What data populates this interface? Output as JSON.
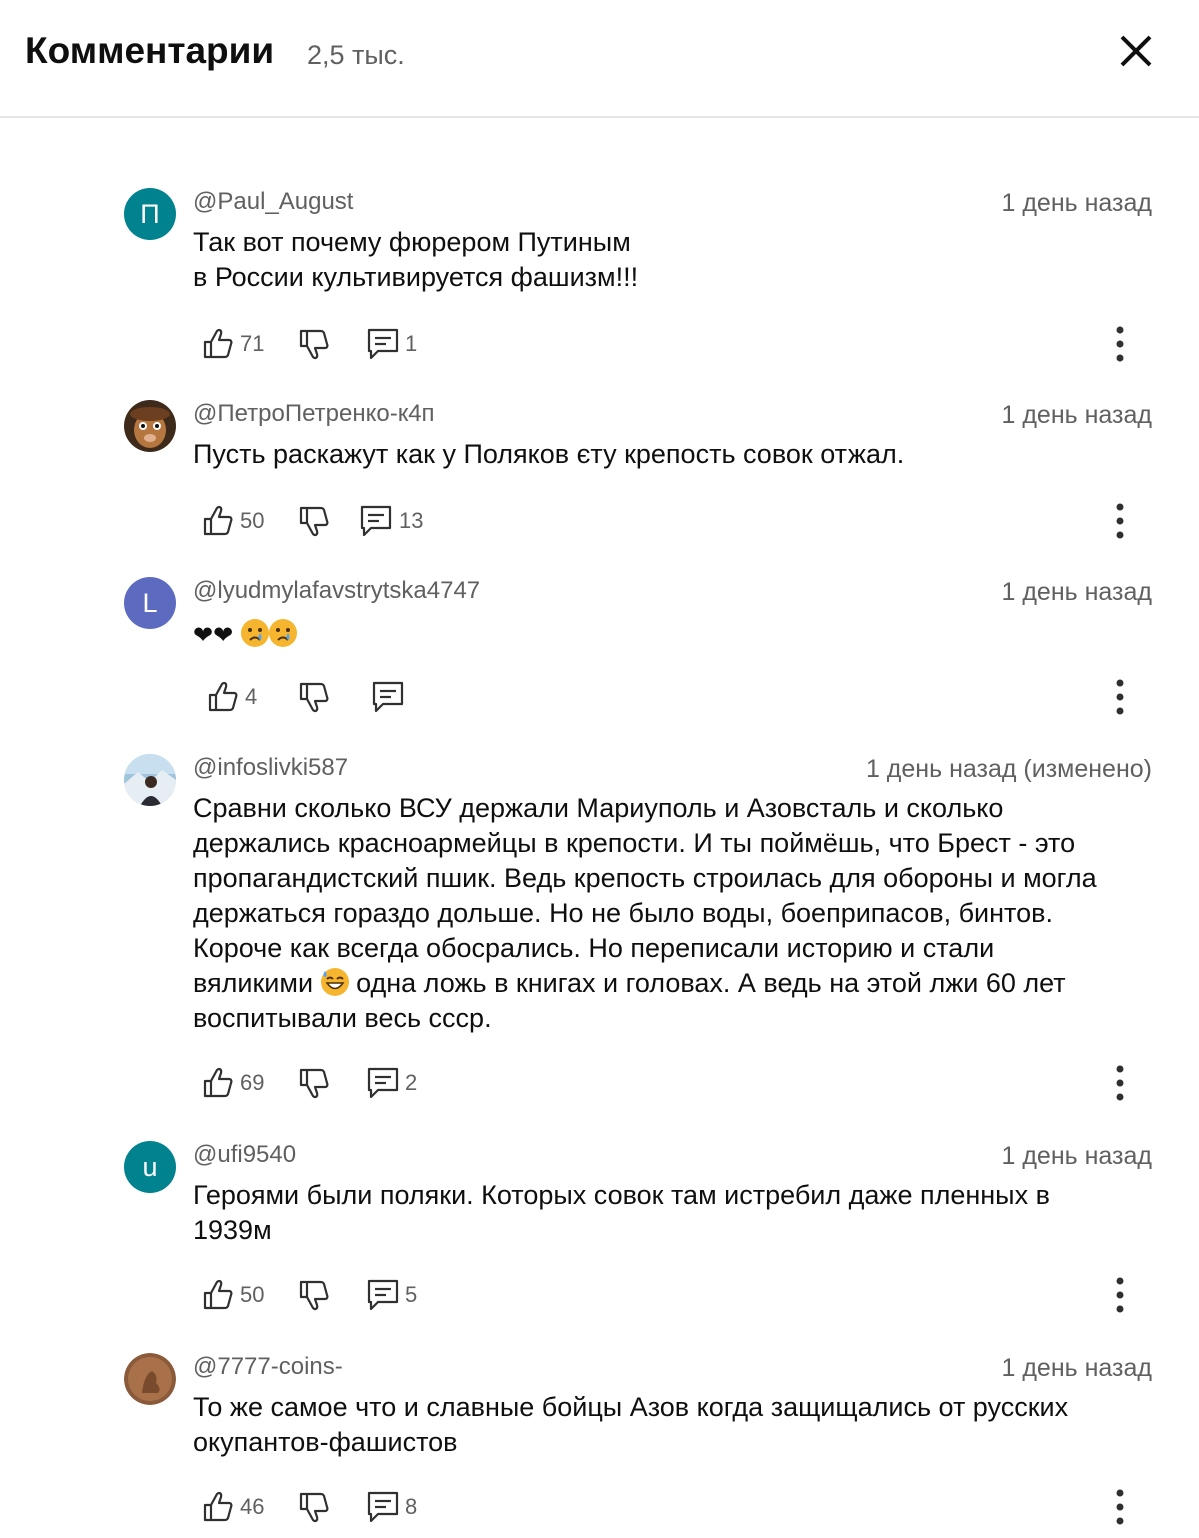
{
  "header": {
    "title": "Комментарии",
    "count": "2,5 тыс."
  },
  "colors": {
    "teal": "#00838f",
    "indigo": "#5c6bc0",
    "secondary": "#606060"
  },
  "comments": [
    {
      "author": "@Paul_August",
      "avatar_letter": "П",
      "time": "1 день назад",
      "lines": [
        "Так вот почему фюрером Путиным",
        "в России культивируется фашизм!!!"
      ],
      "likes": "71",
      "replies": "1"
    },
    {
      "author": "@ПетроПетренко-к4п",
      "avatar_letter": "",
      "time": "1 день назад",
      "lines": [
        "Пусть раскажут как у Поляков єту крепость совок отжал."
      ],
      "likes": "50",
      "replies": "13"
    },
    {
      "author": "@lyudmylafavstrytska4747",
      "avatar_letter": "L",
      "time": "1 день назад",
      "emojis": [
        "❤",
        "❤",
        "😢",
        "😢"
      ],
      "likes": "4",
      "replies": ""
    },
    {
      "author": "@infoslivki587",
      "avatar_letter": "",
      "time": "1 день назад (изменено)",
      "lines": [
        "Сравни сколько ВСУ держали Мариуполь и Азовсталь и сколько",
        "держались красноармейцы в крепости. И ты поймёшь, что Брест - это",
        "пропагандистский пшик. Ведь крепость строилась для обороны и могла",
        "держаться гораздо дольше. Но не было воды, боеприпасов, бинтов.",
        "Короче как всегда обосрались. Но переписали историю и стали"
      ],
      "line6_a": "вяликими",
      "line6_emoji": "😅",
      "line6_b": "одна ложь в книгах и головах. А ведь на этой лжи 60 лет",
      "line7": "воспитывали весь ссср.",
      "likes": "69",
      "replies": "2"
    },
    {
      "author": "@ufi9540",
      "avatar_letter": "u",
      "time": "1 день назад",
      "lines": [
        "Героями были поляки. Которых совок там истребил даже пленных в",
        "1939м"
      ],
      "likes": "50",
      "replies": "5"
    },
    {
      "author": "@7777-coins-",
      "avatar_letter": "",
      "time": "1 день назад",
      "lines": [
        "То же самое что и славные бойцы Азов когда защищались от русских",
        "окупантов-фашистов"
      ],
      "likes": "46",
      "replies": "8"
    }
  ]
}
